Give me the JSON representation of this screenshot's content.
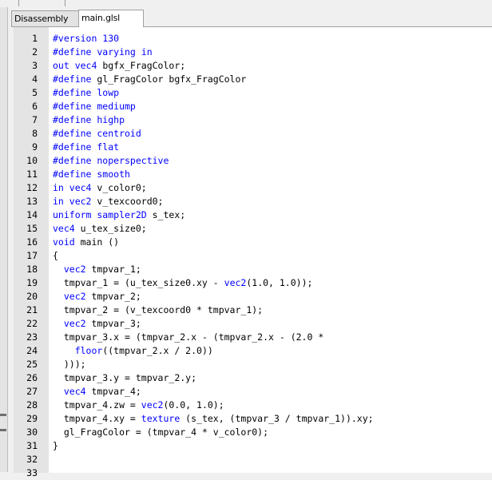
{
  "tabs": [
    {
      "label": "Disassembly",
      "active": false
    },
    {
      "label": "main.glsl",
      "active": true
    }
  ],
  "code_lines": [
    {
      "n": "1",
      "parts": [
        {
          "t": "#version 130",
          "c": "pp"
        }
      ]
    },
    {
      "n": "2",
      "parts": [
        {
          "t": "#define varying in",
          "c": "pp"
        }
      ]
    },
    {
      "n": "3",
      "parts": [
        {
          "t": "out vec4",
          "c": "kw"
        },
        {
          "t": " bgfx_FragColor;",
          "c": ""
        }
      ]
    },
    {
      "n": "4",
      "parts": [
        {
          "t": "#define",
          "c": "pp"
        },
        {
          "t": " gl_FragColor bgfx_FragColor",
          "c": ""
        }
      ]
    },
    {
      "n": "5",
      "parts": [
        {
          "t": "#define lowp",
          "c": "pp"
        }
      ]
    },
    {
      "n": "6",
      "parts": [
        {
          "t": "#define mediump",
          "c": "pp"
        }
      ]
    },
    {
      "n": "7",
      "parts": [
        {
          "t": "#define highp",
          "c": "pp"
        }
      ]
    },
    {
      "n": "8",
      "parts": [
        {
          "t": "#define centroid",
          "c": "pp"
        }
      ]
    },
    {
      "n": "9",
      "parts": [
        {
          "t": "#define flat",
          "c": "pp"
        }
      ]
    },
    {
      "n": "10",
      "parts": [
        {
          "t": "#define noperspective",
          "c": "pp"
        }
      ]
    },
    {
      "n": "11",
      "parts": [
        {
          "t": "#define smooth",
          "c": "pp"
        }
      ]
    },
    {
      "n": "12",
      "parts": [
        {
          "t": "in vec4",
          "c": "kw"
        },
        {
          "t": " v_color0;",
          "c": ""
        }
      ]
    },
    {
      "n": "13",
      "parts": [
        {
          "t": "in vec2",
          "c": "kw"
        },
        {
          "t": " v_texcoord0;",
          "c": ""
        }
      ]
    },
    {
      "n": "14",
      "parts": [
        {
          "t": "uniform sampler2D",
          "c": "kw"
        },
        {
          "t": " s_tex;",
          "c": ""
        }
      ]
    },
    {
      "n": "15",
      "parts": [
        {
          "t": "vec4",
          "c": "kw"
        },
        {
          "t": " u_tex_size0;",
          "c": ""
        }
      ]
    },
    {
      "n": "16",
      "parts": [
        {
          "t": "void",
          "c": "kw"
        },
        {
          "t": " main ()",
          "c": ""
        }
      ]
    },
    {
      "n": "17",
      "parts": [
        {
          "t": "{",
          "c": ""
        }
      ]
    },
    {
      "n": "18",
      "parts": [
        {
          "t": "  ",
          "c": ""
        },
        {
          "t": "vec2",
          "c": "kw"
        },
        {
          "t": " tmpvar_1;",
          "c": ""
        }
      ]
    },
    {
      "n": "19",
      "parts": [
        {
          "t": "  tmpvar_1 = (u_tex_size0.xy - ",
          "c": ""
        },
        {
          "t": "vec2",
          "c": "kw"
        },
        {
          "t": "(1.0, 1.0));",
          "c": ""
        }
      ]
    },
    {
      "n": "20",
      "parts": [
        {
          "t": "  ",
          "c": ""
        },
        {
          "t": "vec2",
          "c": "kw"
        },
        {
          "t": " tmpvar_2;",
          "c": ""
        }
      ]
    },
    {
      "n": "21",
      "parts": [
        {
          "t": "  tmpvar_2 = (v_texcoord0 * tmpvar_1);",
          "c": ""
        }
      ]
    },
    {
      "n": "22",
      "parts": [
        {
          "t": "  ",
          "c": ""
        },
        {
          "t": "vec2",
          "c": "kw"
        },
        {
          "t": " tmpvar_3;",
          "c": ""
        }
      ]
    },
    {
      "n": "23",
      "parts": [
        {
          "t": "  tmpvar_3.x = (tmpvar_2.x - (tmpvar_2.x - (2.0 *",
          "c": ""
        }
      ]
    },
    {
      "n": "24",
      "parts": [
        {
          "t": "    ",
          "c": ""
        },
        {
          "t": "floor",
          "c": "kw"
        },
        {
          "t": "((tmpvar_2.x / 2.0))",
          "c": ""
        }
      ]
    },
    {
      "n": "25",
      "parts": [
        {
          "t": "  )));",
          "c": ""
        }
      ]
    },
    {
      "n": "26",
      "parts": [
        {
          "t": "  tmpvar_3.y = tmpvar_2.y;",
          "c": ""
        }
      ]
    },
    {
      "n": "27",
      "parts": [
        {
          "t": "  ",
          "c": ""
        },
        {
          "t": "vec4",
          "c": "kw"
        },
        {
          "t": " tmpvar_4;",
          "c": ""
        }
      ]
    },
    {
      "n": "28",
      "parts": [
        {
          "t": "  tmpvar_4.zw = ",
          "c": ""
        },
        {
          "t": "vec2",
          "c": "kw"
        },
        {
          "t": "(0.0, 1.0);",
          "c": ""
        }
      ]
    },
    {
      "n": "29",
      "parts": [
        {
          "t": "  tmpvar_4.xy = ",
          "c": ""
        },
        {
          "t": "texture",
          "c": "kw"
        },
        {
          "t": " (s_tex, (tmpvar_3 / tmpvar_1)).xy;",
          "c": ""
        }
      ]
    },
    {
      "n": "30",
      "parts": [
        {
          "t": "  gl_FragColor = (tmpvar_4 * v_color0);",
          "c": ""
        }
      ]
    },
    {
      "n": "31",
      "parts": [
        {
          "t": "}",
          "c": ""
        }
      ]
    },
    {
      "n": "32",
      "parts": []
    },
    {
      "n": "33",
      "parts": []
    }
  ],
  "colors": {
    "keyword": "#0000ff",
    "gutter_bg": "#e4e4e4",
    "editor_bg": "#ffffff"
  }
}
